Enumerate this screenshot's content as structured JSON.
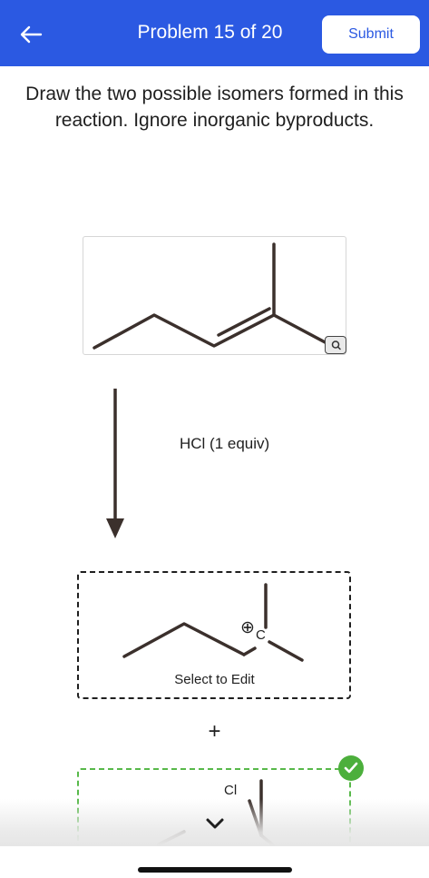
{
  "header": {
    "title": "Problem 15 of 20",
    "submit_label": "Submit",
    "back_icon": "arrow-left-icon",
    "background_color": "#2b59e2"
  },
  "question": {
    "text": "Draw the two possible isomers formed in this reaction. Ignore inorganic byproducts."
  },
  "reactant": {
    "zoom_icon": "magnifier-icon"
  },
  "reaction": {
    "reagent": "HCl (1 equiv)"
  },
  "product1": {
    "charge_symbol": "⊕",
    "atom_label": "C",
    "action_label": "Select to Edit"
  },
  "separator": {
    "plus": "+"
  },
  "product2": {
    "atom_label": "Cl",
    "status_icon": "checkmark-icon",
    "accent_color": "#4caf3c"
  },
  "bottom_bar": {
    "toggle_icon": "chevron-down-icon"
  }
}
